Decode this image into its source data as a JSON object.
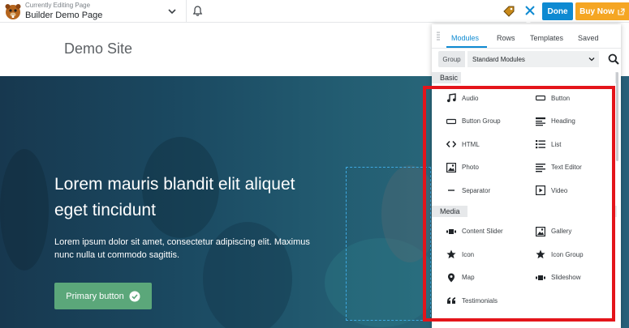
{
  "topbar": {
    "editing_small": "Currently Editing Page",
    "page_name": "Builder Demo Page",
    "done_label": "Done",
    "buy_label": "Buy Now"
  },
  "site": {
    "title": "Demo Site"
  },
  "hero": {
    "title": "Lorem mauris blandit elit aliquet eget tincidunt",
    "text": "Lorem ipsum dolor sit amet, consectetur adipiscing elit. Maximus nunc nulla ut commodo sagittis.",
    "button_label": "Primary button"
  },
  "panel": {
    "tabs": [
      {
        "label": "Modules",
        "active": true
      },
      {
        "label": "Rows",
        "active": false
      },
      {
        "label": "Templates",
        "active": false
      },
      {
        "label": "Saved",
        "active": false
      }
    ],
    "group_label": "Group",
    "group_value": "Standard Modules",
    "categories": [
      {
        "name": "Basic",
        "modules": [
          {
            "label": "Audio",
            "icon": "music-icon"
          },
          {
            "label": "Button",
            "icon": "button-icon"
          },
          {
            "label": "Button Group",
            "icon": "button-group-icon"
          },
          {
            "label": "Heading",
            "icon": "heading-icon"
          },
          {
            "label": "HTML",
            "icon": "code-icon"
          },
          {
            "label": "List",
            "icon": "list-icon"
          },
          {
            "label": "Photo",
            "icon": "photo-icon"
          },
          {
            "label": "Text Editor",
            "icon": "text-editor-icon"
          },
          {
            "label": "Separator",
            "icon": "separator-icon"
          },
          {
            "label": "Video",
            "icon": "video-icon"
          }
        ]
      },
      {
        "name": "Media",
        "modules": [
          {
            "label": "Content Slider",
            "icon": "slider-icon"
          },
          {
            "label": "Gallery",
            "icon": "gallery-icon"
          },
          {
            "label": "Icon",
            "icon": "star-icon"
          },
          {
            "label": "Icon Group",
            "icon": "star-icon"
          },
          {
            "label": "Map",
            "icon": "map-pin-icon"
          },
          {
            "label": "Slideshow",
            "icon": "slideshow-icon"
          },
          {
            "label": "Testimonials",
            "icon": "quote-icon"
          }
        ]
      }
    ]
  },
  "colors": {
    "accent": "#0e8ad2",
    "buy": "#f5a623",
    "cta": "#5ba77a",
    "highlight": "#e4141a"
  }
}
